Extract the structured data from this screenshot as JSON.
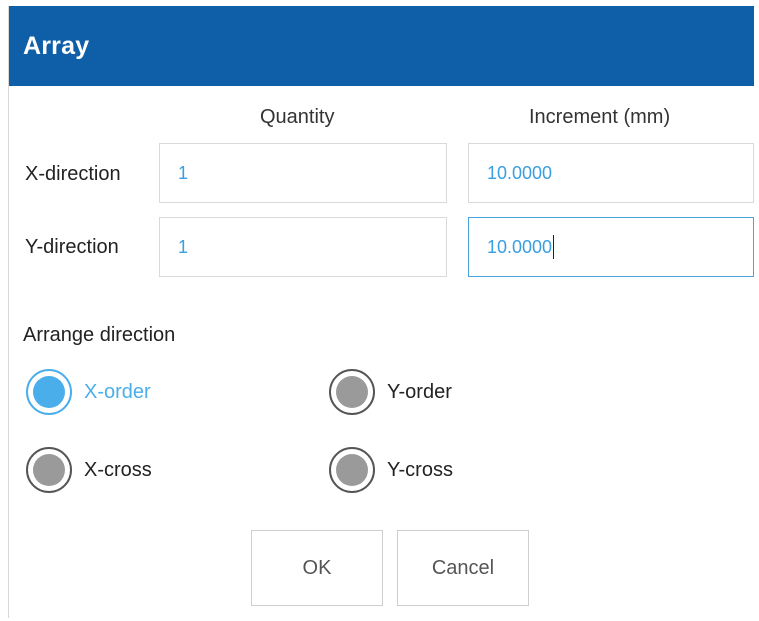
{
  "dialog": {
    "title": "Array"
  },
  "columns": {
    "quantity": "Quantity",
    "increment": "Increment (mm)"
  },
  "rows": {
    "x": {
      "label": "X-direction",
      "quantity": "1",
      "increment": "10.0000"
    },
    "y": {
      "label": "Y-direction",
      "quantity": "1",
      "increment": "10.0000"
    }
  },
  "arrange": {
    "label": "Arrange direction",
    "options": {
      "x_order": "X-order",
      "y_order": "Y-order",
      "x_cross": "X-cross",
      "y_cross": "Y-cross"
    },
    "selected": "X-order"
  },
  "buttons": {
    "ok": "OK",
    "cancel": "Cancel"
  },
  "colors": {
    "titlebar": "#0f5fa8",
    "accent": "#4aaeea",
    "value_text": "#3a9ee0"
  }
}
